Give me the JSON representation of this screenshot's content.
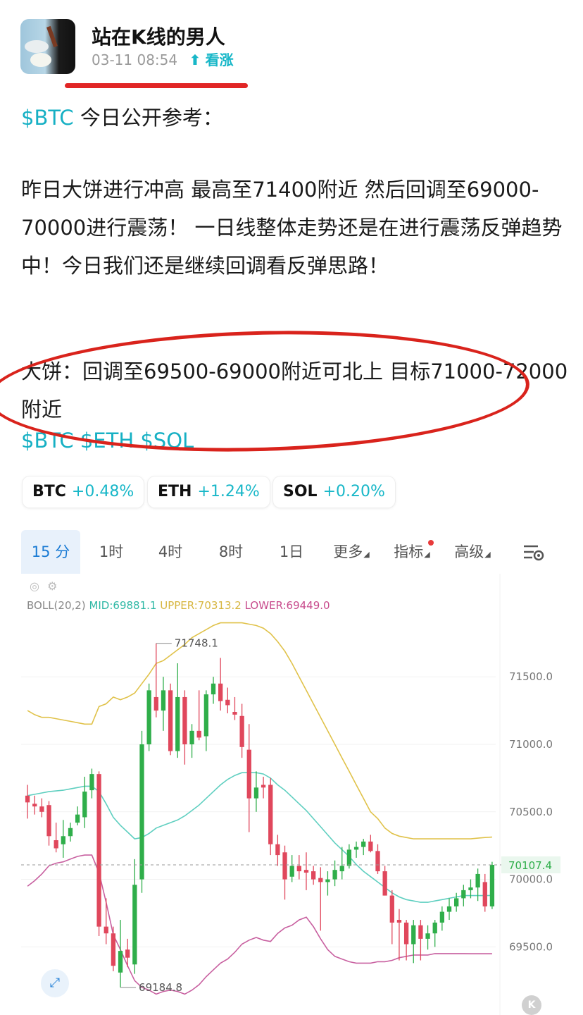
{
  "post": {
    "author": "站在K线的男人",
    "timestamp": "03-11 08:54",
    "sentiment_icon": "arrow-up-icon",
    "sentiment": "看涨",
    "line1_tag": "$BTC",
    "line1_text": " 今日公开参考：",
    "para1": "昨日大饼进行冲高 最高至71400附近 然后回调至69000-70000进行震荡！ 一日线整体走势还是在进行震荡反弹趋势中！今日我们还是继续回调看反弹思路！",
    "para2": "大饼：回调至69500-69000附近可北上 目标71000-72000附近",
    "tags": "$BTC $ETH $SOL"
  },
  "tickers": [
    {
      "symbol": "BTC",
      "change": "+0.48%"
    },
    {
      "symbol": "ETH",
      "change": "+1.24%"
    },
    {
      "symbol": "SOL",
      "change": "+0.20%"
    }
  ],
  "timeframe_tabs": [
    {
      "label": "15 分",
      "active": true
    },
    {
      "label": "1时"
    },
    {
      "label": "4时"
    },
    {
      "label": "8时"
    },
    {
      "label": "1日"
    },
    {
      "label": "更多"
    },
    {
      "label": "指标"
    },
    {
      "label": "高级"
    }
  ],
  "colors": {
    "accent": "#16b0c4",
    "up": "#2fae4a",
    "down": "#e0475c",
    "mid": "#5fcfc0",
    "upper": "#e0c24a",
    "lower": "#c860a0",
    "annotation": "#d9231c"
  },
  "indicator": {
    "name": "BOLL(20,2)",
    "mid": "MID:69881.1",
    "upper": "UPPER:70313.2",
    "lower": "LOWER:69449.0"
  },
  "chart_data": {
    "type": "candlestick",
    "symbol": "BTC",
    "interval": "15 分",
    "ylim": [
      69100,
      71950
    ],
    "y_ticks": [
      "71500.0",
      "71000.0",
      "70500.0",
      "70000.0",
      "69500.0"
    ],
    "last_price": "70107.4",
    "high_label": "71748.1",
    "low_label": "69184.8",
    "candles": [
      {
        "o": 70620,
        "h": 70700,
        "l": 70450,
        "c": 70570
      },
      {
        "o": 70560,
        "h": 70620,
        "l": 70480,
        "c": 70540
      },
      {
        "o": 70540,
        "h": 70600,
        "l": 70460,
        "c": 70500
      },
      {
        "o": 70550,
        "h": 70580,
        "l": 70250,
        "c": 70320
      },
      {
        "o": 70290,
        "h": 70420,
        "l": 70200,
        "c": 70230
      },
      {
        "o": 70260,
        "h": 70440,
        "l": 70160,
        "c": 70320
      },
      {
        "o": 70320,
        "h": 70420,
        "l": 70280,
        "c": 70380
      },
      {
        "o": 70420,
        "h": 70540,
        "l": 70400,
        "c": 70480
      },
      {
        "o": 70460,
        "h": 70760,
        "l": 70380,
        "c": 70650
      },
      {
        "o": 70660,
        "h": 70820,
        "l": 70600,
        "c": 70780
      },
      {
        "o": 70780,
        "h": 70800,
        "l": 69580,
        "c": 69650
      },
      {
        "o": 69650,
        "h": 69860,
        "l": 69520,
        "c": 69600
      },
      {
        "o": 69600,
        "h": 69650,
        "l": 69320,
        "c": 69360
      },
      {
        "o": 69310,
        "h": 69700,
        "l": 69200,
        "c": 69470
      },
      {
        "o": 69480,
        "h": 69560,
        "l": 69350,
        "c": 69420
      },
      {
        "o": 69370,
        "h": 70150,
        "l": 69300,
        "c": 69960
      },
      {
        "o": 70000,
        "h": 71100,
        "l": 69900,
        "c": 71000
      },
      {
        "o": 71000,
        "h": 71450,
        "l": 70950,
        "c": 71400
      },
      {
        "o": 71350,
        "h": 71748,
        "l": 71200,
        "c": 71250
      },
      {
        "o": 71250,
        "h": 71500,
        "l": 71100,
        "c": 71400
      },
      {
        "o": 71400,
        "h": 71450,
        "l": 70920,
        "c": 70950
      },
      {
        "o": 70950,
        "h": 71600,
        "l": 70900,
        "c": 71350
      },
      {
        "o": 71350,
        "h": 71400,
        "l": 70850,
        "c": 71000
      },
      {
        "o": 71000,
        "h": 71150,
        "l": 70900,
        "c": 71100
      },
      {
        "o": 71100,
        "h": 71400,
        "l": 71030,
        "c": 71050
      },
      {
        "o": 71060,
        "h": 71400,
        "l": 70950,
        "c": 71370
      },
      {
        "o": 71370,
        "h": 71500,
        "l": 71300,
        "c": 71450
      },
      {
        "o": 71450,
        "h": 71640,
        "l": 71250,
        "c": 71320
      },
      {
        "o": 71330,
        "h": 71420,
        "l": 71230,
        "c": 71290
      },
      {
        "o": 71240,
        "h": 71350,
        "l": 71180,
        "c": 71220
      },
      {
        "o": 71210,
        "h": 71300,
        "l": 70900,
        "c": 70980
      },
      {
        "o": 70960,
        "h": 71150,
        "l": 70350,
        "c": 70600
      },
      {
        "o": 70600,
        "h": 70800,
        "l": 70500,
        "c": 70680
      },
      {
        "o": 70700,
        "h": 70760,
        "l": 70600,
        "c": 70680
      },
      {
        "o": 70700,
        "h": 70750,
        "l": 70180,
        "c": 70260
      },
      {
        "o": 70260,
        "h": 70330,
        "l": 70100,
        "c": 70180
      },
      {
        "o": 70200,
        "h": 70250,
        "l": 69850,
        "c": 70000
      },
      {
        "o": 70020,
        "h": 70180,
        "l": 69980,
        "c": 70100
      },
      {
        "o": 70100,
        "h": 70180,
        "l": 70000,
        "c": 70060
      },
      {
        "o": 70070,
        "h": 70200,
        "l": 69920,
        "c": 70050
      },
      {
        "o": 70060,
        "h": 70100,
        "l": 69960,
        "c": 70000
      },
      {
        "o": 70010,
        "h": 70090,
        "l": 69620,
        "c": 69980
      },
      {
        "o": 69980,
        "h": 70060,
        "l": 69880,
        "c": 70000
      },
      {
        "o": 70000,
        "h": 70140,
        "l": 69950,
        "c": 70070
      },
      {
        "o": 70060,
        "h": 70240,
        "l": 70000,
        "c": 70100
      },
      {
        "o": 70100,
        "h": 70260,
        "l": 70080,
        "c": 70220
      },
      {
        "o": 70220,
        "h": 70280,
        "l": 70160,
        "c": 70240
      },
      {
        "o": 70240,
        "h": 70300,
        "l": 70180,
        "c": 70280
      },
      {
        "o": 70280,
        "h": 70330,
        "l": 70200,
        "c": 70210
      },
      {
        "o": 70210,
        "h": 70260,
        "l": 70040,
        "c": 70060
      },
      {
        "o": 70060,
        "h": 70100,
        "l": 69880,
        "c": 69880
      },
      {
        "o": 69880,
        "h": 69920,
        "l": 69520,
        "c": 69680
      },
      {
        "o": 69700,
        "h": 69780,
        "l": 69400,
        "c": 69680
      },
      {
        "o": 69680,
        "h": 69700,
        "l": 69400,
        "c": 69520
      },
      {
        "o": 69520,
        "h": 69700,
        "l": 69380,
        "c": 69660
      },
      {
        "o": 69660,
        "h": 69700,
        "l": 69400,
        "c": 69560
      },
      {
        "o": 69560,
        "h": 69660,
        "l": 69480,
        "c": 69600
      },
      {
        "o": 69600,
        "h": 69700,
        "l": 69500,
        "c": 69680
      },
      {
        "o": 69680,
        "h": 69800,
        "l": 69620,
        "c": 69760
      },
      {
        "o": 69760,
        "h": 69860,
        "l": 69700,
        "c": 69800
      },
      {
        "o": 69800,
        "h": 69900,
        "l": 69760,
        "c": 69860
      },
      {
        "o": 69860,
        "h": 69960,
        "l": 69800,
        "c": 69920
      },
      {
        "o": 69920,
        "h": 70000,
        "l": 69860,
        "c": 69940
      },
      {
        "o": 69940,
        "h": 70080,
        "l": 69840,
        "c": 70040
      },
      {
        "o": 69980,
        "h": 70040,
        "l": 69760,
        "c": 69800
      },
      {
        "o": 69800,
        "h": 70130,
        "l": 69780,
        "c": 70107.4
      }
    ],
    "boll_mid": [
      70620,
      70630,
      70640,
      70650,
      70655,
      70660,
      70670,
      70680,
      70690,
      70690,
      70650,
      70560,
      70460,
      70400,
      70350,
      70300,
      70310,
      70340,
      70380,
      70400,
      70420,
      70440,
      70470,
      70510,
      70550,
      70600,
      70650,
      70700,
      70740,
      70770,
      70790,
      70790,
      70790,
      70780,
      70750,
      70700,
      70660,
      70610,
      70560,
      70510,
      70450,
      70390,
      70330,
      70270,
      70220,
      70170,
      70110,
      70060,
      70020,
      69980,
      69940,
      69900,
      69870,
      69850,
      69840,
      69830,
      69830,
      69840,
      69850,
      69860,
      69870,
      69880,
      69880,
      69880,
      69880,
      69881.1
    ],
    "boll_upper": [
      71250,
      71220,
      71200,
      71200,
      71190,
      71180,
      71170,
      71160,
      71150,
      71150,
      71280,
      71300,
      71350,
      71330,
      71350,
      71380,
      71450,
      71520,
      71600,
      71620,
      71660,
      71700,
      71740,
      71790,
      71820,
      71850,
      71880,
      71900,
      71900,
      71900,
      71900,
      71890,
      71880,
      71860,
      71820,
      71760,
      71690,
      71600,
      71500,
      71400,
      71300,
      71200,
      71100,
      71000,
      70900,
      70800,
      70700,
      70600,
      70500,
      70450,
      70380,
      70340,
      70320,
      70310,
      70300,
      70300,
      70300,
      70300,
      70300,
      70300,
      70300,
      70300,
      70300,
      70305,
      70310,
      70313.2
    ],
    "boll_lower": [
      69950,
      69990,
      70040,
      70100,
      70120,
      70130,
      70150,
      70170,
      70180,
      70180,
      70050,
      69830,
      69590,
      69480,
      69360,
      69250,
      69200,
      69180,
      69150,
      69170,
      69180,
      69170,
      69150,
      69180,
      69220,
      69280,
      69330,
      69380,
      69410,
      69460,
      69520,
      69550,
      69570,
      69550,
      69540,
      69600,
      69640,
      69660,
      69700,
      69720,
      69650,
      69560,
      69480,
      69430,
      69410,
      69390,
      69380,
      69380,
      69380,
      69390,
      69390,
      69400,
      69420,
      69430,
      69440,
      69440,
      69440,
      69450,
      69450,
      69450,
      69450,
      69450,
      69449,
      69449,
      69449,
      69449.0
    ]
  }
}
